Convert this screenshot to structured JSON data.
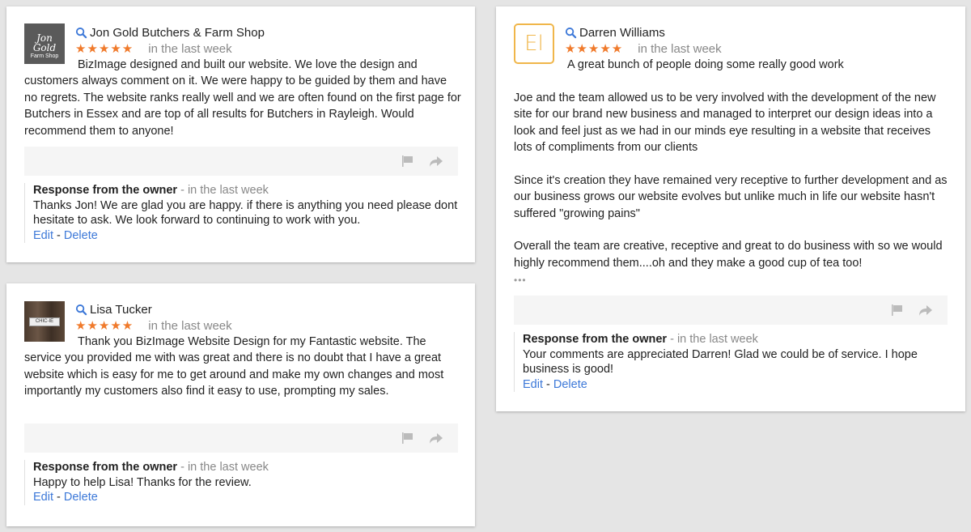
{
  "reviews": [
    {
      "name": "Jon Gold Butchers & Farm Shop",
      "avatar_text": "Jon Gold",
      "avatar_subtext": "Farm Shop",
      "stars": "★★★★★",
      "time": "in the last week",
      "body_first": "BizImage designed and built our website. We love the design and",
      "body_rest": "customers always comment on it. We were happy to be guided by them and have no regrets. The website ranks really well and we are often found on the first page for Butchers in Essex and are top of all results for Butchers in Rayleigh. Would recommend them to anyone!",
      "response_title": "Response from the owner",
      "response_time": " - in the last week",
      "response_text": "Thanks Jon! We are glad you are happy. if there is anything you need please dont hesitate to ask. We look forward to continuing to work with you."
    },
    {
      "name": "Lisa Tucker",
      "avatar_text": "CHIC-IE",
      "stars": "★★★★★",
      "time": "in the last week",
      "body_first": "Thank you BizImage Website Design for my Fantastic website. The",
      "body_rest": "service you provided me with was great and there is no doubt that I have a great website which is easy for me to get around and make my own changes and most importantly my customers also find it easy to use, prompting my sales.",
      "response_title": "Response from the owner",
      "response_time": " - in the last week",
      "response_text": "Happy to help Lisa! Thanks for the review."
    },
    {
      "name": "Darren Williams",
      "avatar_text": "El",
      "stars": "★★★★★",
      "time": "in the last week",
      "body_first": "A great bunch of people doing some really good work",
      "para1": "Joe and the team allowed us to be very involved with the development of the new site for our brand new business and managed to interpret our design ideas into a look and feel just as we had in our minds eye resulting in a website that receives lots of compliments from our clients",
      "para2": "Since it's creation they have remained very receptive to further development and as our business grows our website evolves but unlike much in life our website hasn't suffered \"growing pains\"",
      "para3": "Overall the team are creative, receptive and great to do business with so we would highly recommend them....oh and they make a good cup of tea too!",
      "more": "•••",
      "response_title": "Response from the owner",
      "response_time": " - in the last week",
      "response_text": "Your comments are appreciated Darren! Glad we could be of service. I hope business is good!"
    }
  ],
  "links": {
    "edit": "Edit",
    "separator": " - ",
    "delete": "Delete"
  },
  "colors": {
    "star": "#f07a2b",
    "link": "#3c78d8",
    "muted": "#888888",
    "avatar_border_el": "#f0b64a"
  }
}
